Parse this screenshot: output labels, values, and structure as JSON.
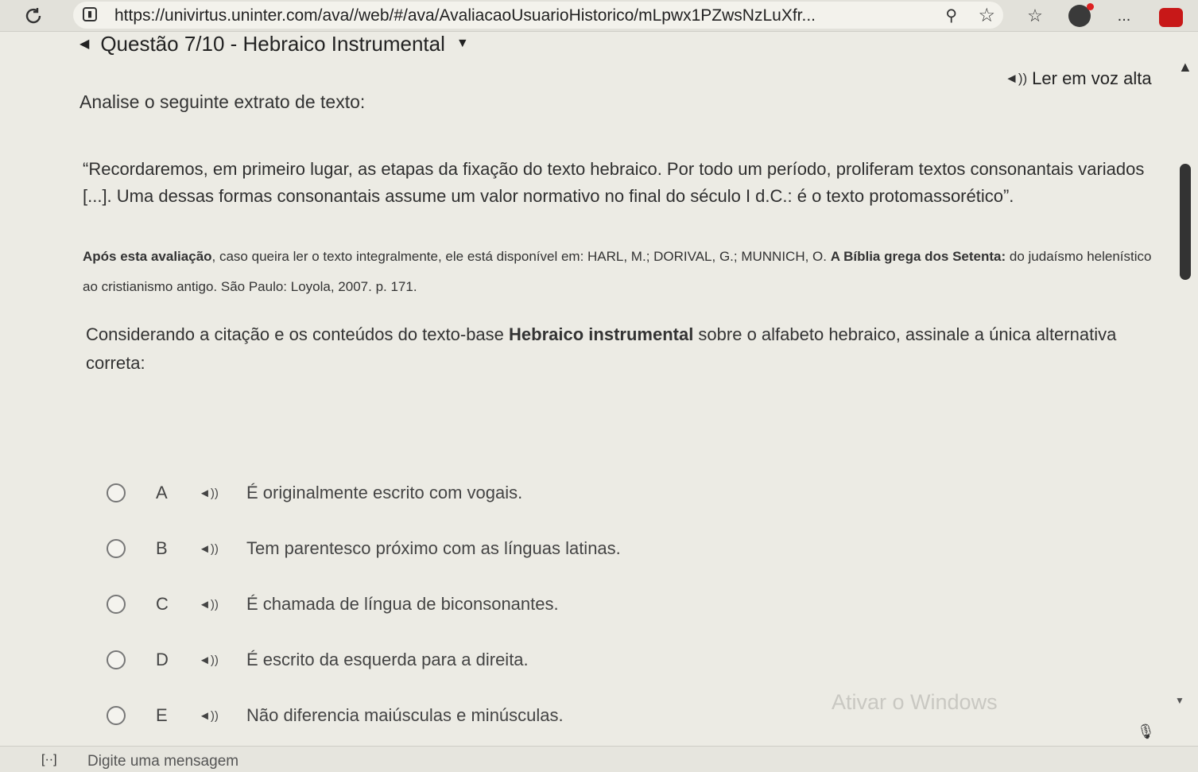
{
  "browser": {
    "url": "https://univirtus.uninter.com/ava//web/#/ava/AvaliacaoUsuarioHistorico/mLpwx1PZwsNzLuXfr...",
    "refresh_icon": "refresh-icon",
    "menu_label": "..."
  },
  "question": {
    "header": "Questão 7/10 - Hebraico Instrumental",
    "read_aloud": "Ler em voz alta",
    "prompt": "Analise o seguinte extrato de texto:",
    "quote": "“Recordaremos, em primeiro lugar, as etapas da fixação do texto hebraico. Por todo um período, proliferam textos consonantais variados [...]. Uma dessas formas consonantais assume um valor normativo no final do século I d.C.: é o texto protomassorético”.",
    "ref_part1": "Após esta avaliação",
    "ref_part2": ", caso queira ler o texto integralmente, ele está disponível em: HARL, M.; DORIVAL, G.; MUNNICH, O. ",
    "ref_bold": "A Bíblia grega dos Setenta:",
    "ref_part3": " do judaísmo helenístico ao cristianismo antigo. São Paulo: Loyola, 2007. p. 171.",
    "instruction_part1": "Considerando a citação e os conteúdos do texto-base ",
    "instruction_bold": "Hebraico instrumental",
    "instruction_part2": " sobre o alfabeto hebraico, assinale a única alternativa correta:"
  },
  "options": [
    {
      "letter": "A",
      "text": "É originalmente escrito com vogais."
    },
    {
      "letter": "B",
      "text": "Tem parentesco próximo com as línguas latinas."
    },
    {
      "letter": "C",
      "text": "É chamada de língua de biconsonantes."
    },
    {
      "letter": "D",
      "text": "É escrito da esquerda para a direita."
    },
    {
      "letter": "E",
      "text": "Não diferencia maiúsculas e minúsculas."
    }
  ],
  "watermark": "Ativar o Windows",
  "message_bar": {
    "placeholder": "Digite uma mensagem"
  }
}
